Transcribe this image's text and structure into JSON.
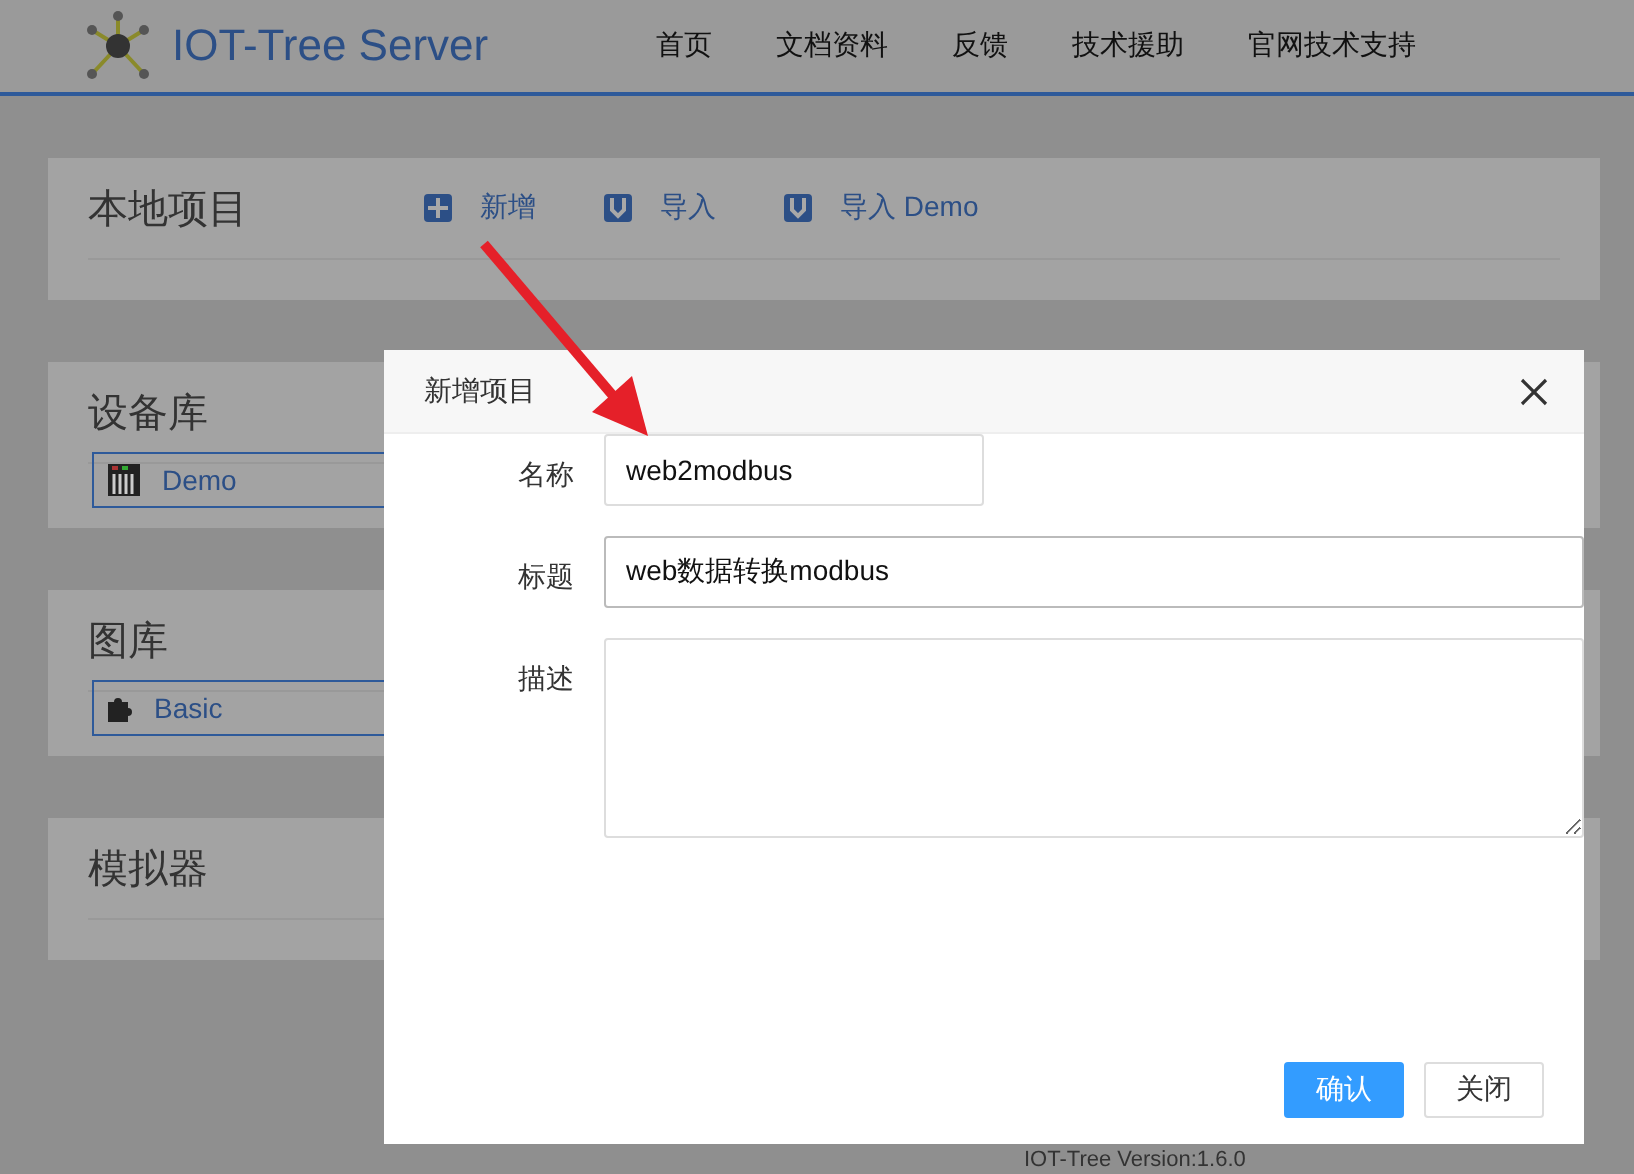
{
  "header": {
    "logo_text": "IOT-Tree Server",
    "nav": [
      "首页",
      "文档资料",
      "反馈",
      "技术援助",
      "官网技术支持"
    ]
  },
  "sections": [
    {
      "title": "本地项目",
      "actions": [
        {
          "kind": "add",
          "label": "新增"
        },
        {
          "kind": "import",
          "label": "导入"
        },
        {
          "kind": "import",
          "label": "导入 Demo"
        }
      ]
    },
    {
      "title": "设备库",
      "items": [
        {
          "kind": "device",
          "label": "Demo"
        }
      ]
    },
    {
      "title": "图库",
      "items": [
        {
          "kind": "puzzle",
          "label": "Basic"
        }
      ]
    },
    {
      "title": "模拟器"
    }
  ],
  "footer": "IOT-Tree Version:1.6.0",
  "dialog": {
    "title": "新增项目",
    "fields": [
      {
        "kind": "short",
        "label": "名称",
        "value": "web2modbus"
      },
      {
        "kind": "wide",
        "label": "标题",
        "value": "web数据转换modbus"
      },
      {
        "kind": "area",
        "label": "描述"
      }
    ],
    "buttons": [
      {
        "kind": "primary",
        "label": "确认"
      },
      {
        "kind": "plain",
        "label": "关闭"
      }
    ]
  }
}
